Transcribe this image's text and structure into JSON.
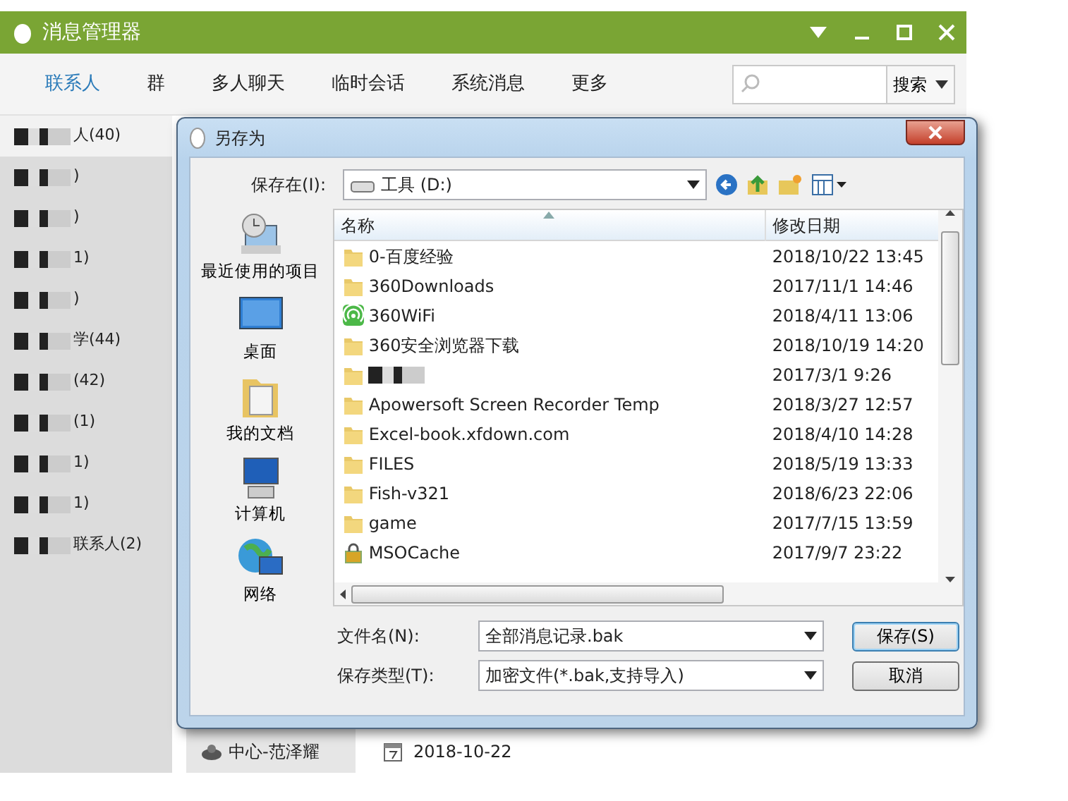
{
  "app": {
    "title": "消息管理器",
    "tabs": [
      {
        "label": "联系人",
        "selected": true
      },
      {
        "label": "群",
        "selected": false
      },
      {
        "label": "多人聊天",
        "selected": false
      },
      {
        "label": "临时会话",
        "selected": false
      },
      {
        "label": "系统消息",
        "selected": false
      },
      {
        "label": "更多",
        "selected": false
      }
    ],
    "search": {
      "button": "搜索"
    }
  },
  "contacts": [
    {
      "text": "人(40)"
    },
    {
      "text": ")"
    },
    {
      "text": ")"
    },
    {
      "text": "1)"
    },
    {
      "text": ")"
    },
    {
      "text": "学(44)"
    },
    {
      "text": "(42)"
    },
    {
      "text": "(1)"
    },
    {
      "text": "1)"
    },
    {
      "text": "1)"
    },
    {
      "text": "联系人(2)"
    }
  ],
  "message": {
    "sender": "中心-范泽耀",
    "date": "2018-10-22"
  },
  "dialog": {
    "title": "另存为",
    "save_in": {
      "label": "保存在(I):",
      "value": "工具  (D:)"
    },
    "places": [
      {
        "label": "最近使用的项目",
        "kind": "recent"
      },
      {
        "label": "桌面",
        "kind": "desktop"
      },
      {
        "label": "我的文档",
        "kind": "documents"
      },
      {
        "label": "计算机",
        "kind": "computer"
      },
      {
        "label": "网络",
        "kind": "network"
      }
    ],
    "columns": [
      "名称",
      "修改日期"
    ],
    "files": [
      {
        "name": "0-百度经验",
        "date": "2018/10/22 13:45",
        "kind": "folder"
      },
      {
        "name": "360Downloads",
        "date": "2017/11/1 14:46",
        "kind": "folder"
      },
      {
        "name": "360WiFi",
        "date": "2018/4/11 13:06",
        "kind": "wifi"
      },
      {
        "name": "360安全浏览器下载",
        "date": "2018/10/19 14:20",
        "kind": "folder"
      },
      {
        "date": "2017/3/1 9:26",
        "kind": "folder"
      },
      {
        "name": "Apowersoft Screen Recorder Temp",
        "date": "2018/3/27 12:57",
        "kind": "folder"
      },
      {
        "name": "Excel-book.xfdown.com",
        "date": "2018/4/10 14:28",
        "kind": "folder"
      },
      {
        "name": "FILES",
        "date": "2018/5/19 13:33",
        "kind": "folder"
      },
      {
        "name": "Fish-v321",
        "date": "2018/6/23 22:06",
        "kind": "folder"
      },
      {
        "name": "game",
        "date": "2017/7/15 13:59",
        "kind": "folder"
      },
      {
        "name": "MSOCache",
        "date": "2017/9/7 23:22",
        "kind": "locked"
      }
    ],
    "filename": {
      "label": "文件名(N):",
      "value": "全部消息记录.bak"
    },
    "filetype": {
      "label": "保存类型(T):",
      "value": "加密文件(*.bak,支持导入)"
    },
    "buttons": [
      {
        "label": "保存(S)",
        "kind": "primary"
      },
      {
        "label": "取消",
        "kind": "normal"
      }
    ]
  }
}
